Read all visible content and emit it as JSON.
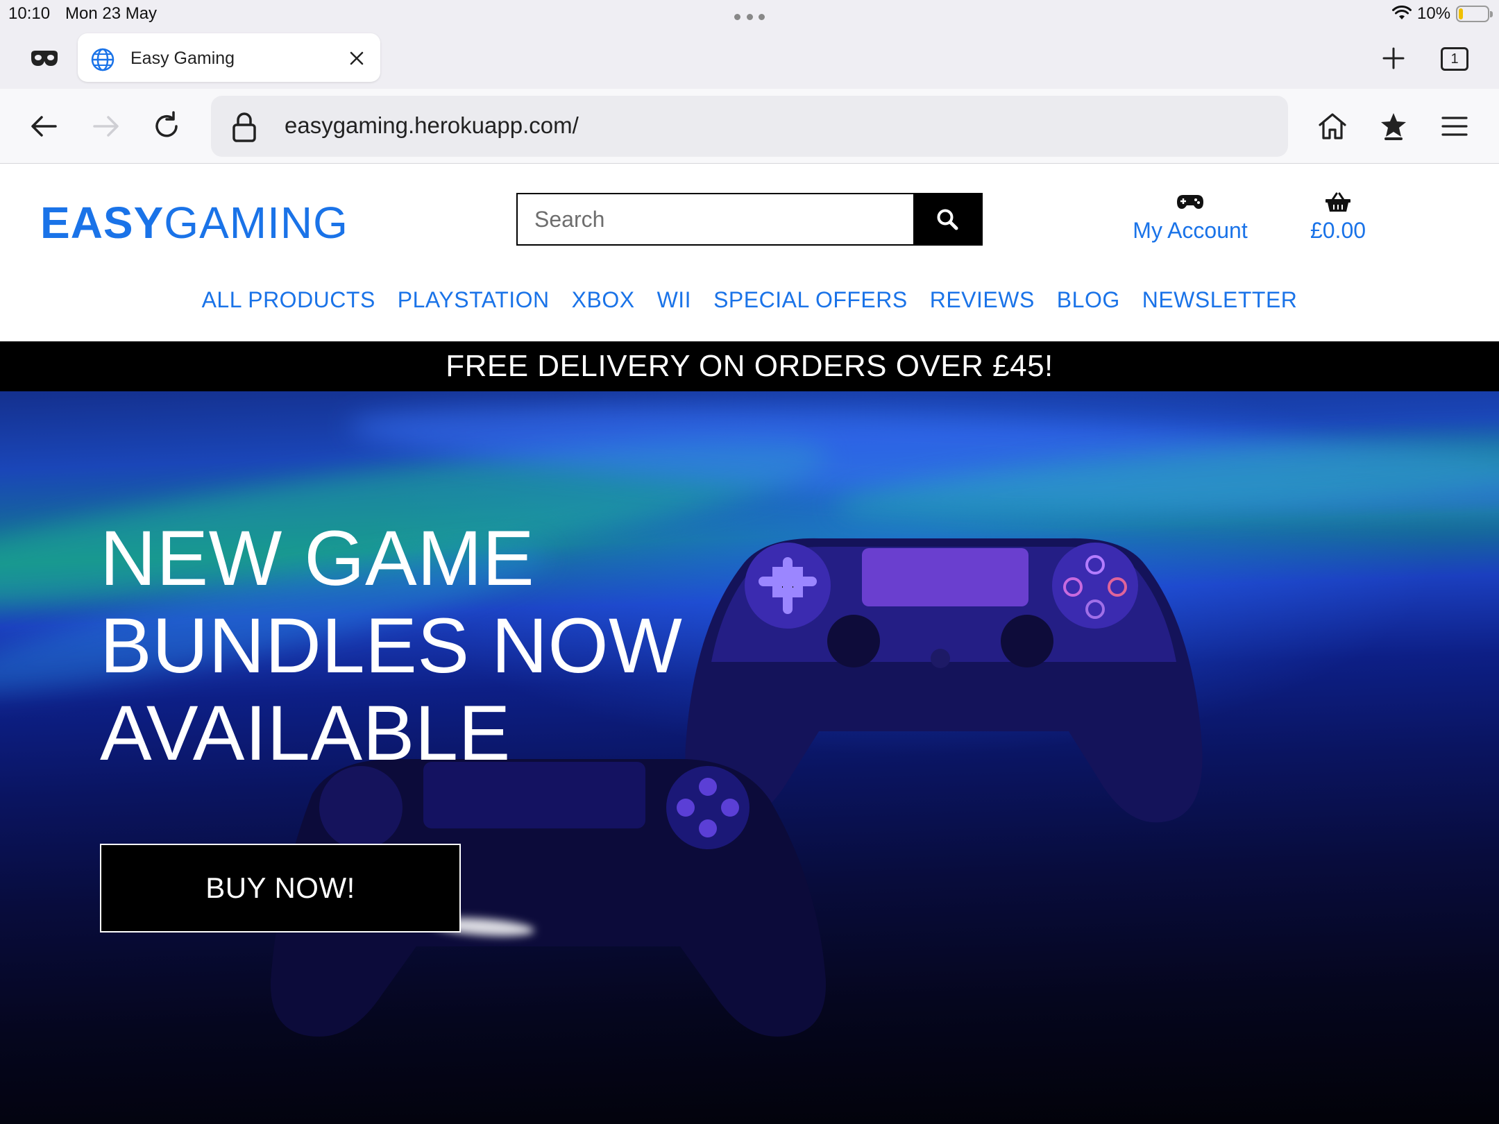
{
  "status_bar": {
    "time": "10:10",
    "date": "Mon 23 May",
    "battery_percent": "10%",
    "battery_level": 0.1
  },
  "browser": {
    "tab": {
      "title": "Easy Gaming",
      "icon": "globe-icon"
    },
    "tab_count": "1",
    "url": "easygaming.herokuapp.com/",
    "toolbar_icons": [
      "back-arrow-icon",
      "forward-arrow-icon",
      "reload-icon",
      "lock-icon",
      "home-icon",
      "bookmark-star-icon",
      "menu-icon"
    ],
    "accent_color": "#1a73e8"
  },
  "site": {
    "logo_part1": "EASY",
    "logo_part2": "GAMING",
    "search": {
      "placeholder": "Search",
      "value": ""
    },
    "account_label": "My Account",
    "basket_total": "£0.00",
    "nav": [
      "ALL PRODUCTS",
      "PLAYSTATION",
      "XBOX",
      "WII",
      "SPECIAL OFFERS",
      "REVIEWS",
      "BLOG",
      "NEWSLETTER"
    ],
    "banner": "FREE DELIVERY ON ORDERS OVER £45!",
    "hero": {
      "title_line1": "NEW GAME",
      "title_line2": "BUNDLES NOW",
      "title_line3": "AVAILABLE",
      "cta": "BUY NOW!"
    },
    "link_color": "#1a73e8"
  }
}
